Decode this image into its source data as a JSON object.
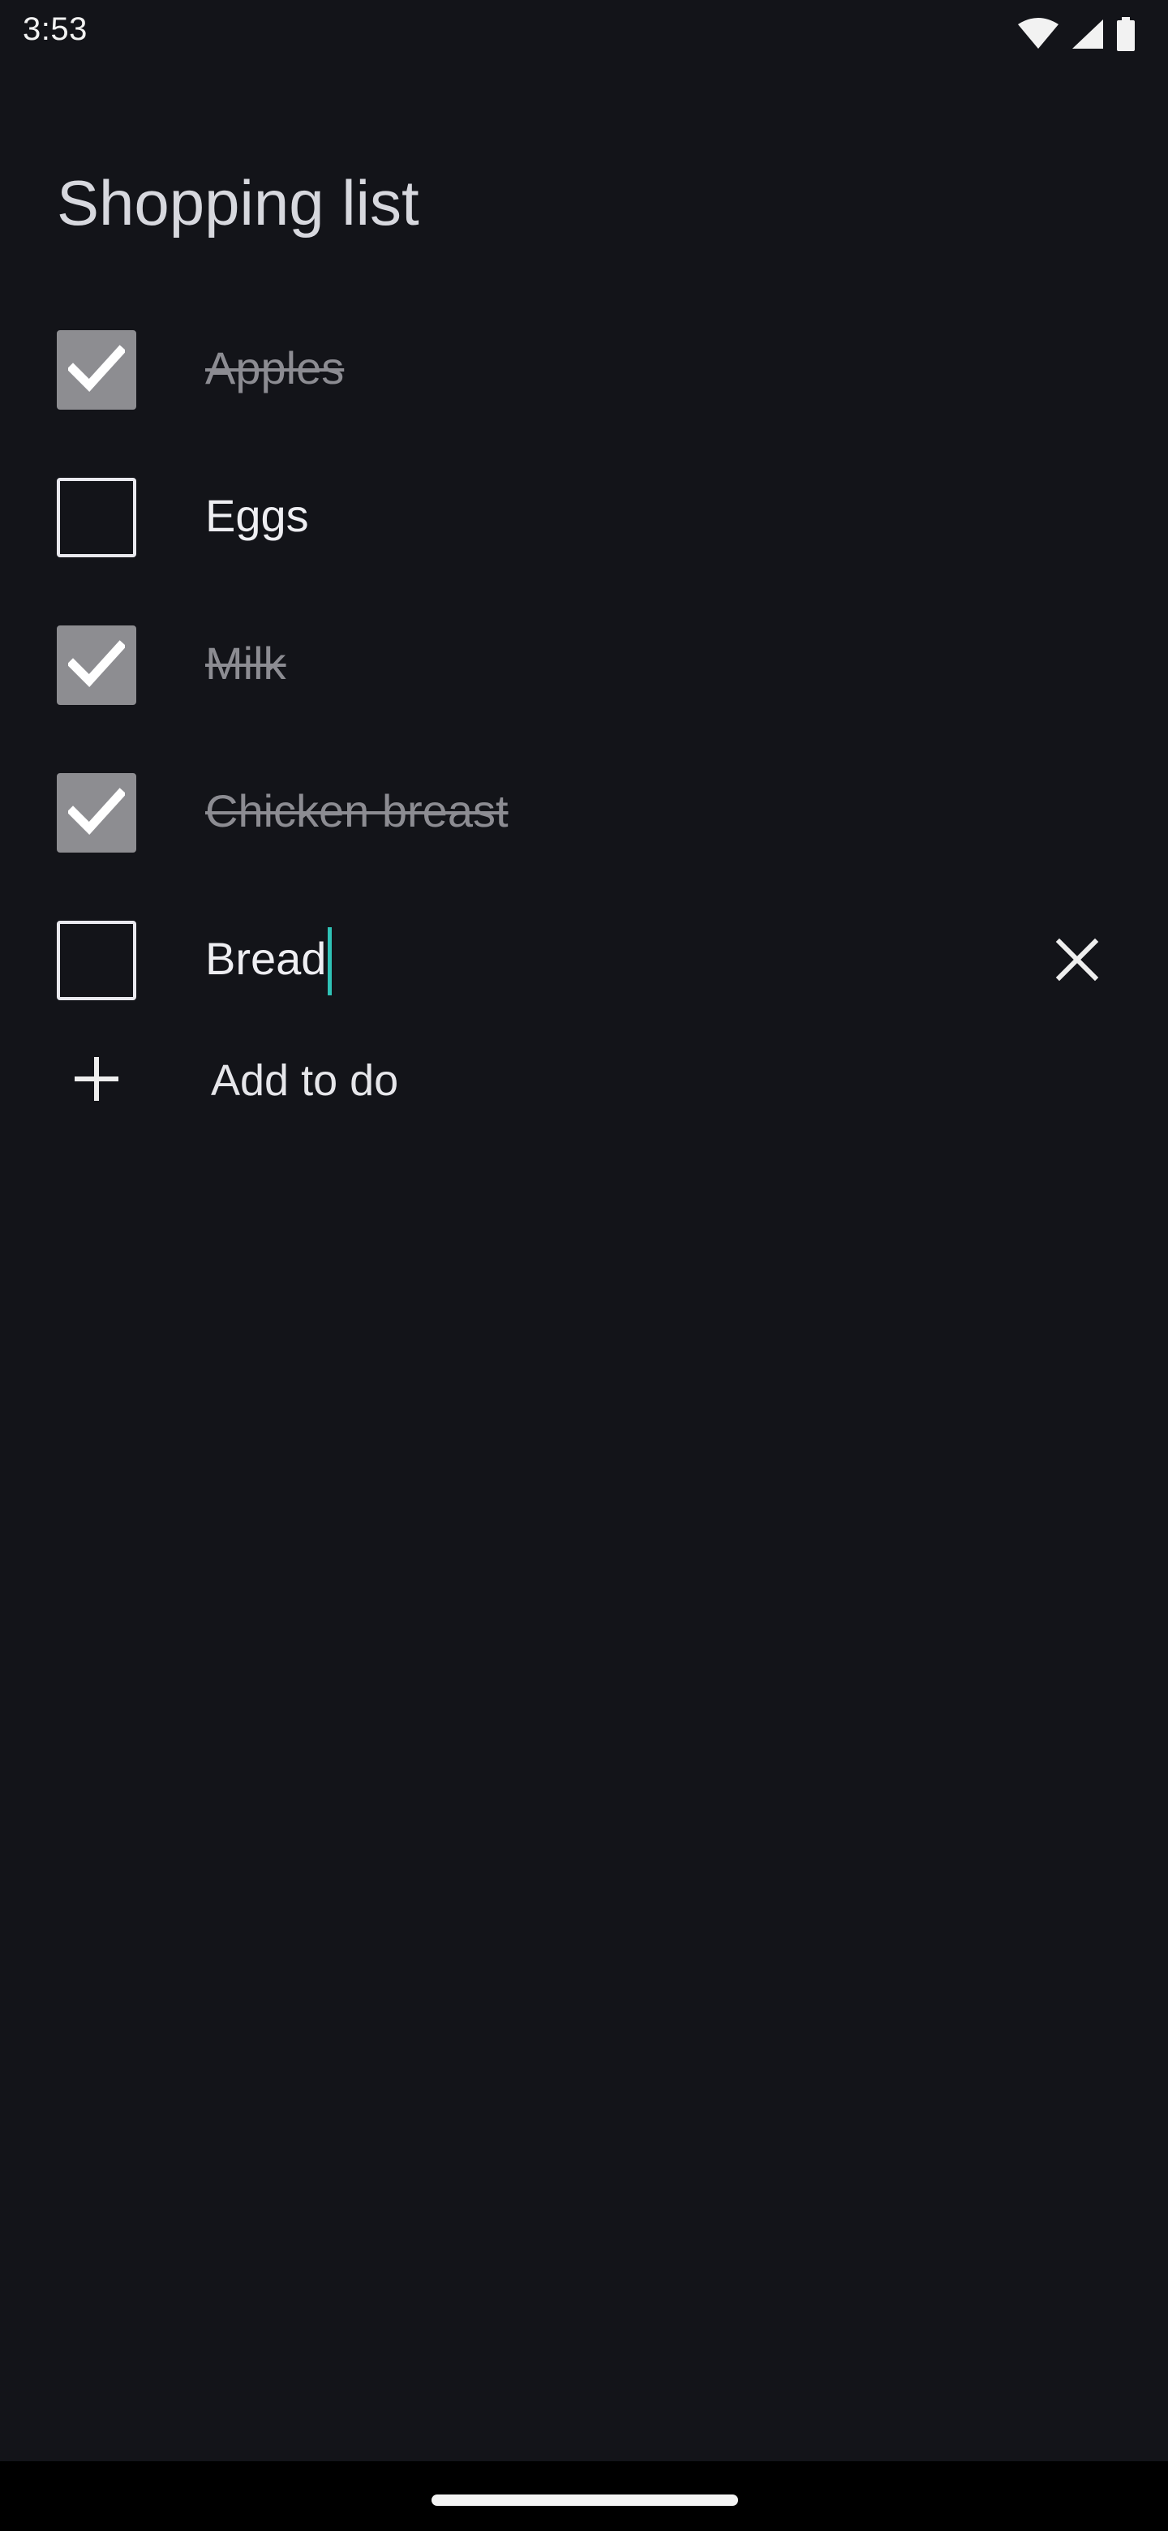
{
  "status_bar": {
    "time": "3:53",
    "icons": [
      "wifi-icon",
      "signal-icon",
      "battery-icon"
    ]
  },
  "page": {
    "title": "Shopping list"
  },
  "todos": [
    {
      "label": "Apples",
      "checked": true
    },
    {
      "label": "Eggs",
      "checked": false
    },
    {
      "label": "Milk",
      "checked": true
    },
    {
      "label": "Chicken breast",
      "checked": true
    },
    {
      "label": "Bread",
      "checked": false,
      "editing": true
    }
  ],
  "add_row": {
    "label": "Add to do",
    "icon": "plus-icon"
  },
  "colors": {
    "background": "#131419",
    "checked_box": "#8d8d91",
    "cursor": "#2fc2b6"
  }
}
